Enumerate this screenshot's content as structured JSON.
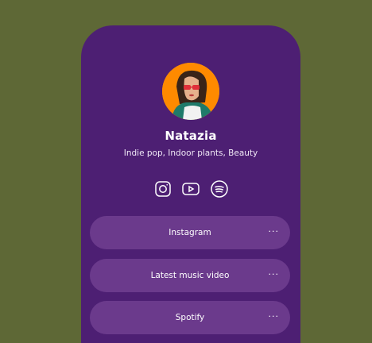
{
  "profile": {
    "name": "Natazia",
    "tagline": "Indie pop, Indoor plants, Beauty",
    "avatar": "woman-with-sunglasses-photo"
  },
  "socials": [
    {
      "icon": "instagram-icon"
    },
    {
      "icon": "youtube-icon"
    },
    {
      "icon": "spotify-icon"
    }
  ],
  "links": [
    {
      "label": "Instagram",
      "menu": "···"
    },
    {
      "label": "Latest music video",
      "menu": "···"
    },
    {
      "label": "Spotify",
      "menu": "···"
    }
  ],
  "colors": {
    "background": "#5e6836",
    "card": "#4d1f73",
    "button": "#6b3a8c",
    "avatar_bg": "#ff8a00"
  }
}
